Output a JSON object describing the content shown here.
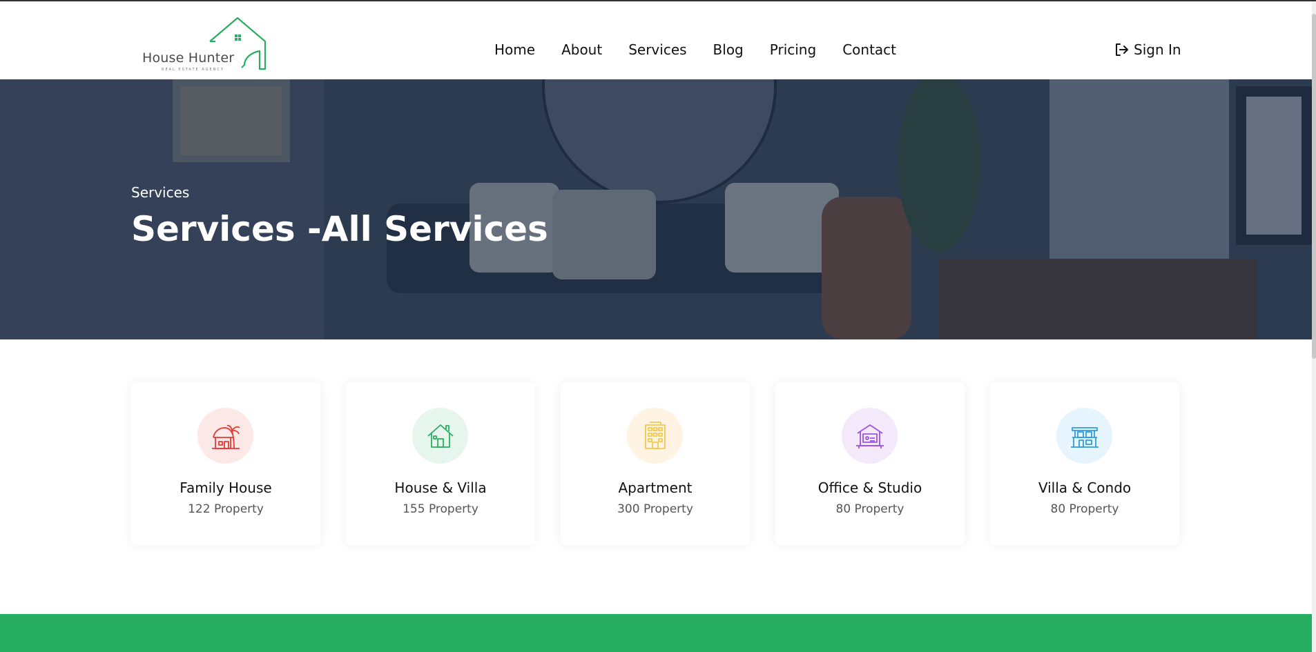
{
  "brand": {
    "name": "House Hunter",
    "tagline": "REAL ESTATE AGENCY",
    "color": "#27ae60"
  },
  "nav": {
    "items": [
      "Home",
      "About",
      "Services",
      "Blog",
      "Pricing",
      "Contact"
    ]
  },
  "signin": {
    "label": "Sign In",
    "icon": "sign-in-icon"
  },
  "hero": {
    "subtitle": "Services",
    "title": "Services -All Services"
  },
  "categories": [
    {
      "title": "Family House",
      "count": "122 Property",
      "icon": "beach-hut-icon",
      "color": "#e53935",
      "bg": "#fde8e8"
    },
    {
      "title": "House & Villa",
      "count": "155 Property",
      "icon": "house-icon",
      "color": "#27ae60",
      "bg": "#e6f6ec"
    },
    {
      "title": "Apartment",
      "count": "300 Property",
      "icon": "apartment-building-icon",
      "color": "#f2c94c",
      "bg": "#fff4e3"
    },
    {
      "title": "Office & Studio",
      "count": "80 Property",
      "icon": "office-studio-icon",
      "color": "#9b51e0",
      "bg": "#f4e8fb"
    },
    {
      "title": "Villa & Condo",
      "count": "80 Property",
      "icon": "villa-condo-icon",
      "color": "#2d9cdb",
      "bg": "#e6f4fd"
    }
  ]
}
